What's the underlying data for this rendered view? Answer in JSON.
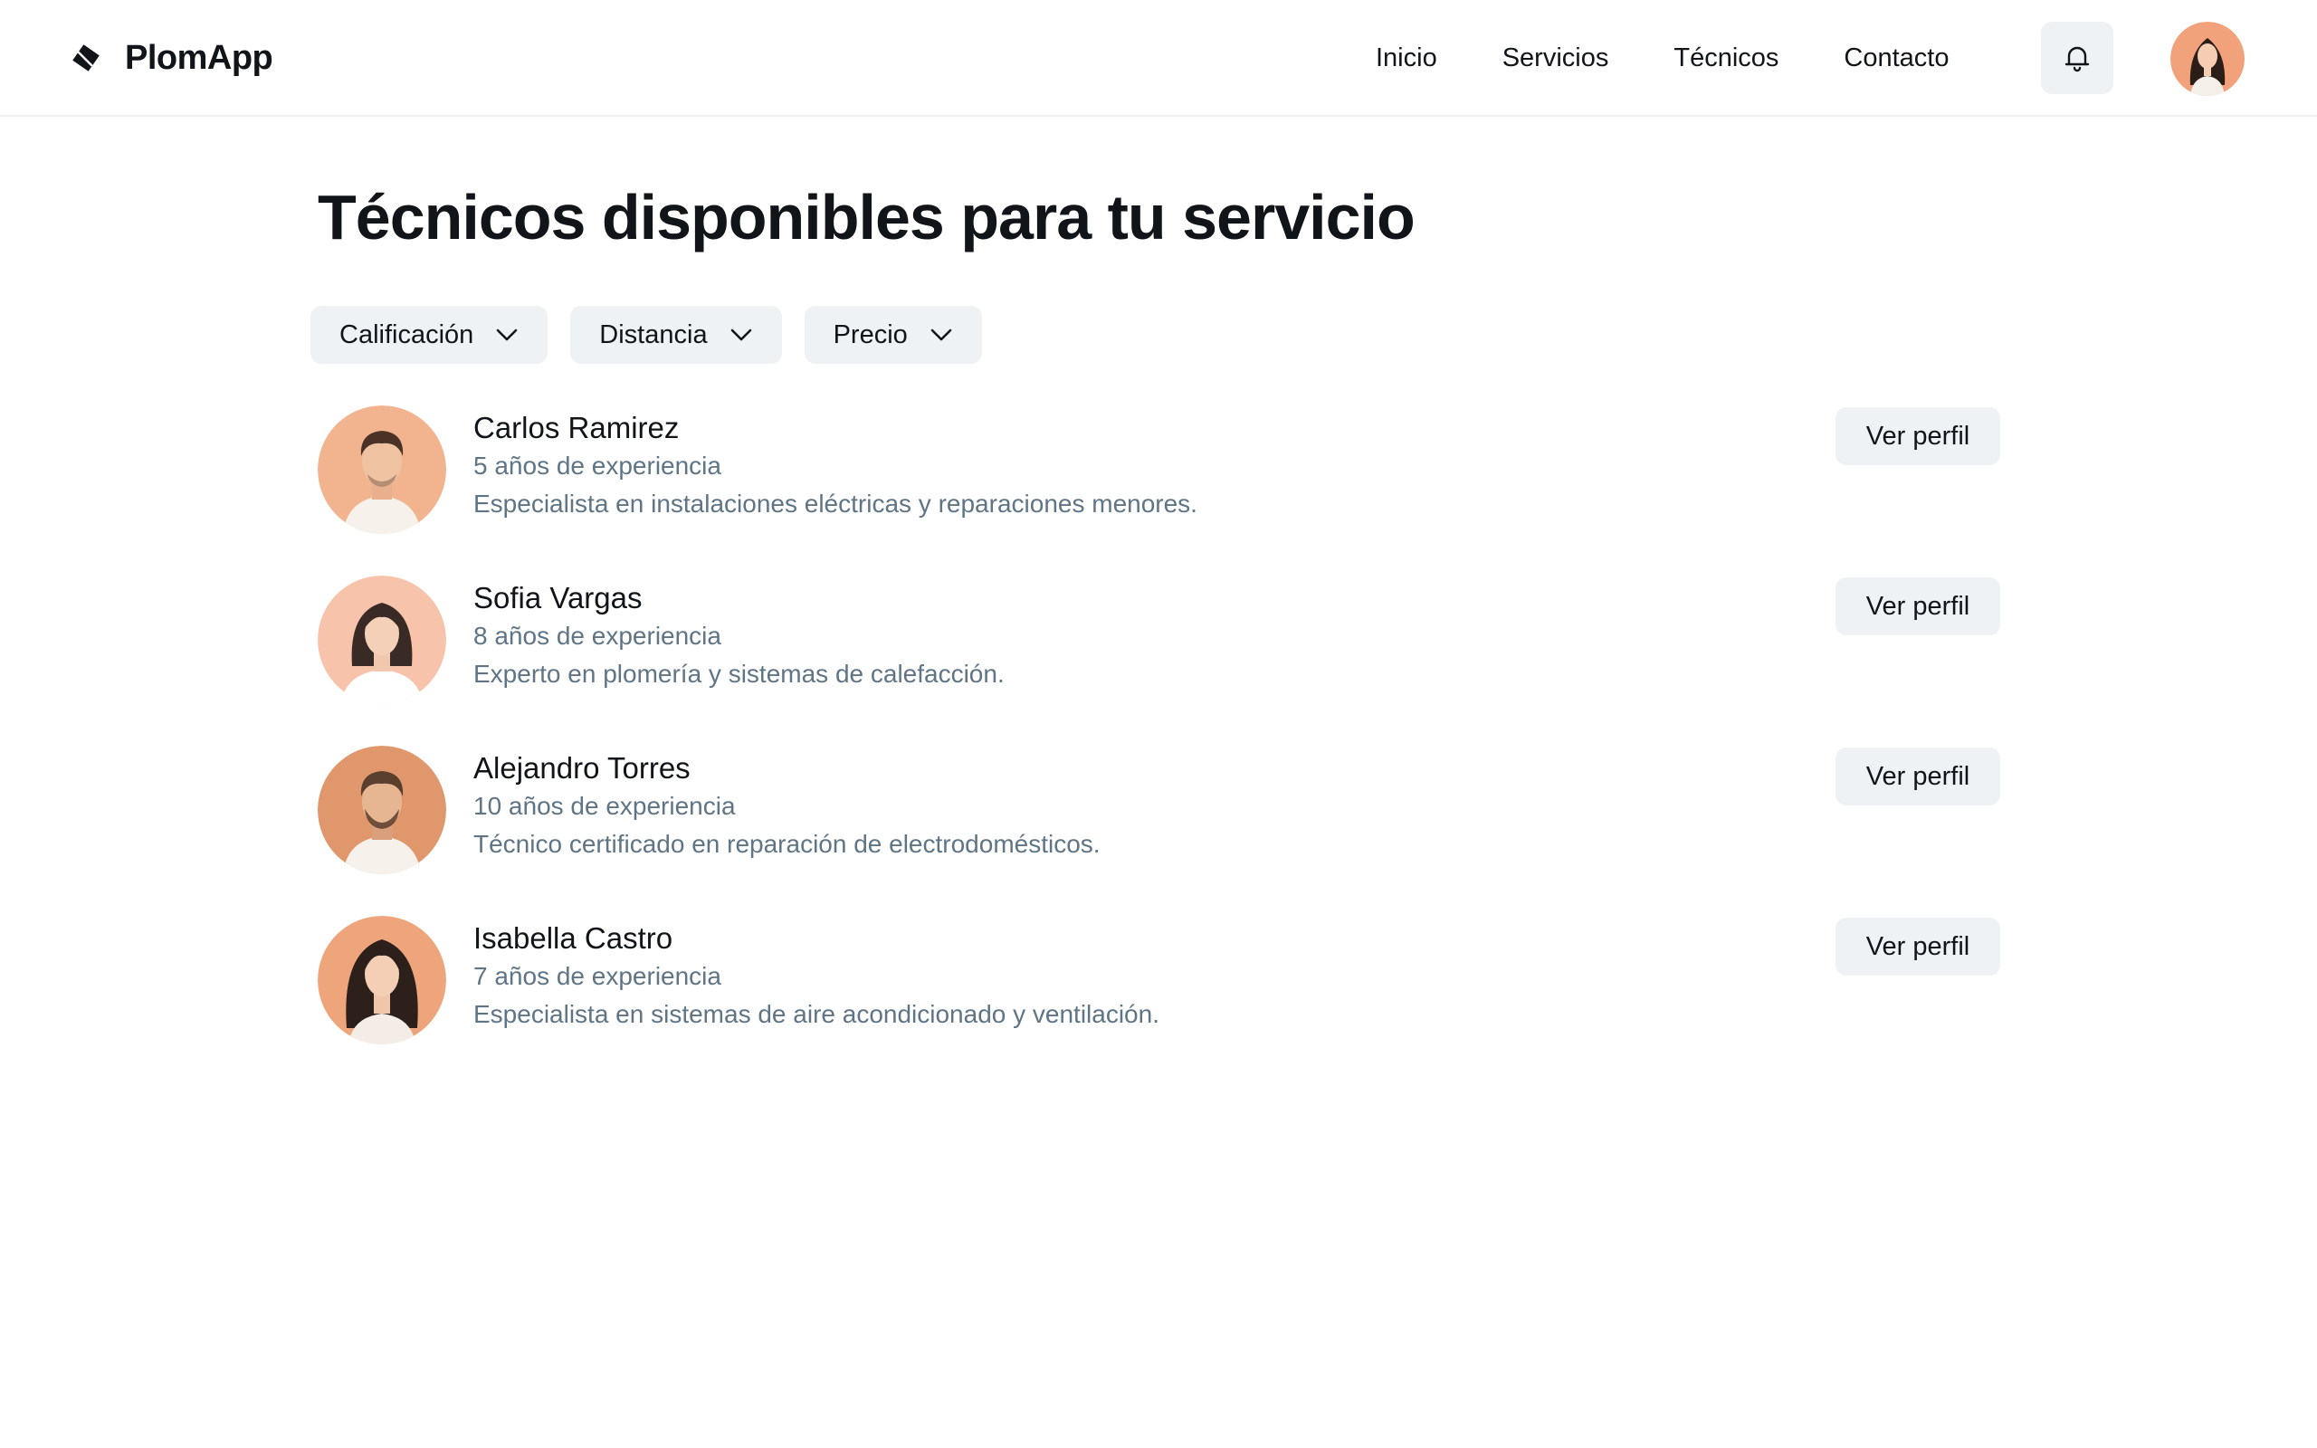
{
  "header": {
    "brand": "PlomApp",
    "nav": [
      "Inicio",
      "Servicios",
      "Técnicos",
      "Contacto"
    ],
    "icons": {
      "brand": "diamond-logo-icon",
      "notifications": "bell-icon",
      "avatar": "user-avatar"
    }
  },
  "main": {
    "title": "Técnicos disponibles para tu servicio",
    "filters": [
      "Calificación",
      "Distancia",
      "Precio"
    ],
    "technicians": [
      {
        "name": "Carlos Ramirez",
        "experience": "5 años de experiencia",
        "description": "Especialista en instalaciones eléctricas y reparaciones menores.",
        "button": "Ver perfil"
      },
      {
        "name": "Sofia Vargas",
        "experience": "8 años de experiencia",
        "description": "Experto en plomería y sistemas de calefacción.",
        "button": "Ver perfil"
      },
      {
        "name": "Alejandro Torres",
        "experience": "10 años de experiencia",
        "description": "Técnico certificado en reparación de electrodomésticos.",
        "button": "Ver perfil"
      },
      {
        "name": "Isabella Castro",
        "experience": "7 años de experiencia",
        "description": "Especialista en sistemas de aire acondicionado y ventilación.",
        "button": "Ver perfil"
      }
    ]
  },
  "colors": {
    "text": "#111418",
    "muted_text": "#5f7485",
    "chip_background": "#eff2f4",
    "avatar_background": "#f2b48f",
    "divider": "#eef0f2"
  }
}
